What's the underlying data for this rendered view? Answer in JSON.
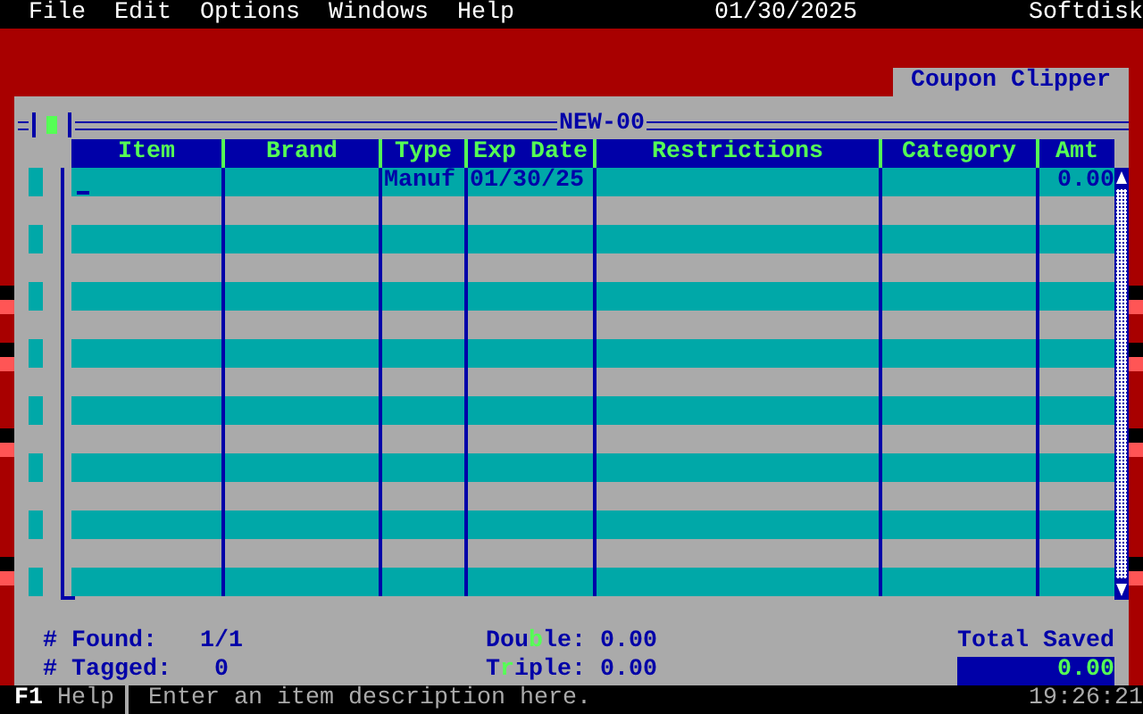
{
  "menu": [
    {
      "label": "File"
    },
    {
      "label": "Edit"
    },
    {
      "label": "Options"
    },
    {
      "label": "Windows"
    },
    {
      "label": "Help"
    }
  ],
  "date": "01/30/2025",
  "brand": "Softdisk",
  "app_tab": "Coupon Clipper",
  "window": {
    "title": "NEW-00"
  },
  "table": {
    "columns": [
      "Item",
      "Brand",
      "Type",
      "Exp Date",
      "Restrictions",
      "Category",
      "Amt"
    ],
    "rows": [
      {
        "cells": [
          "",
          "",
          "Manuf",
          "01/30/25",
          "",
          "",
          "0.00"
        ]
      }
    ]
  },
  "summary": {
    "found_label": "# Found:",
    "found": "1/1",
    "tagged_label": "# Tagged:",
    "tagged": "0",
    "double": "Dou**b**le: 0.00",
    "triple": "T**r**iple: 0.00",
    "total_label": "Total Saved",
    "total": "0.00"
  },
  "status_bar": {
    "key": "F1",
    "key_label": "Help",
    "message": "Enter an item description here.",
    "time": "19:26:21"
  }
}
